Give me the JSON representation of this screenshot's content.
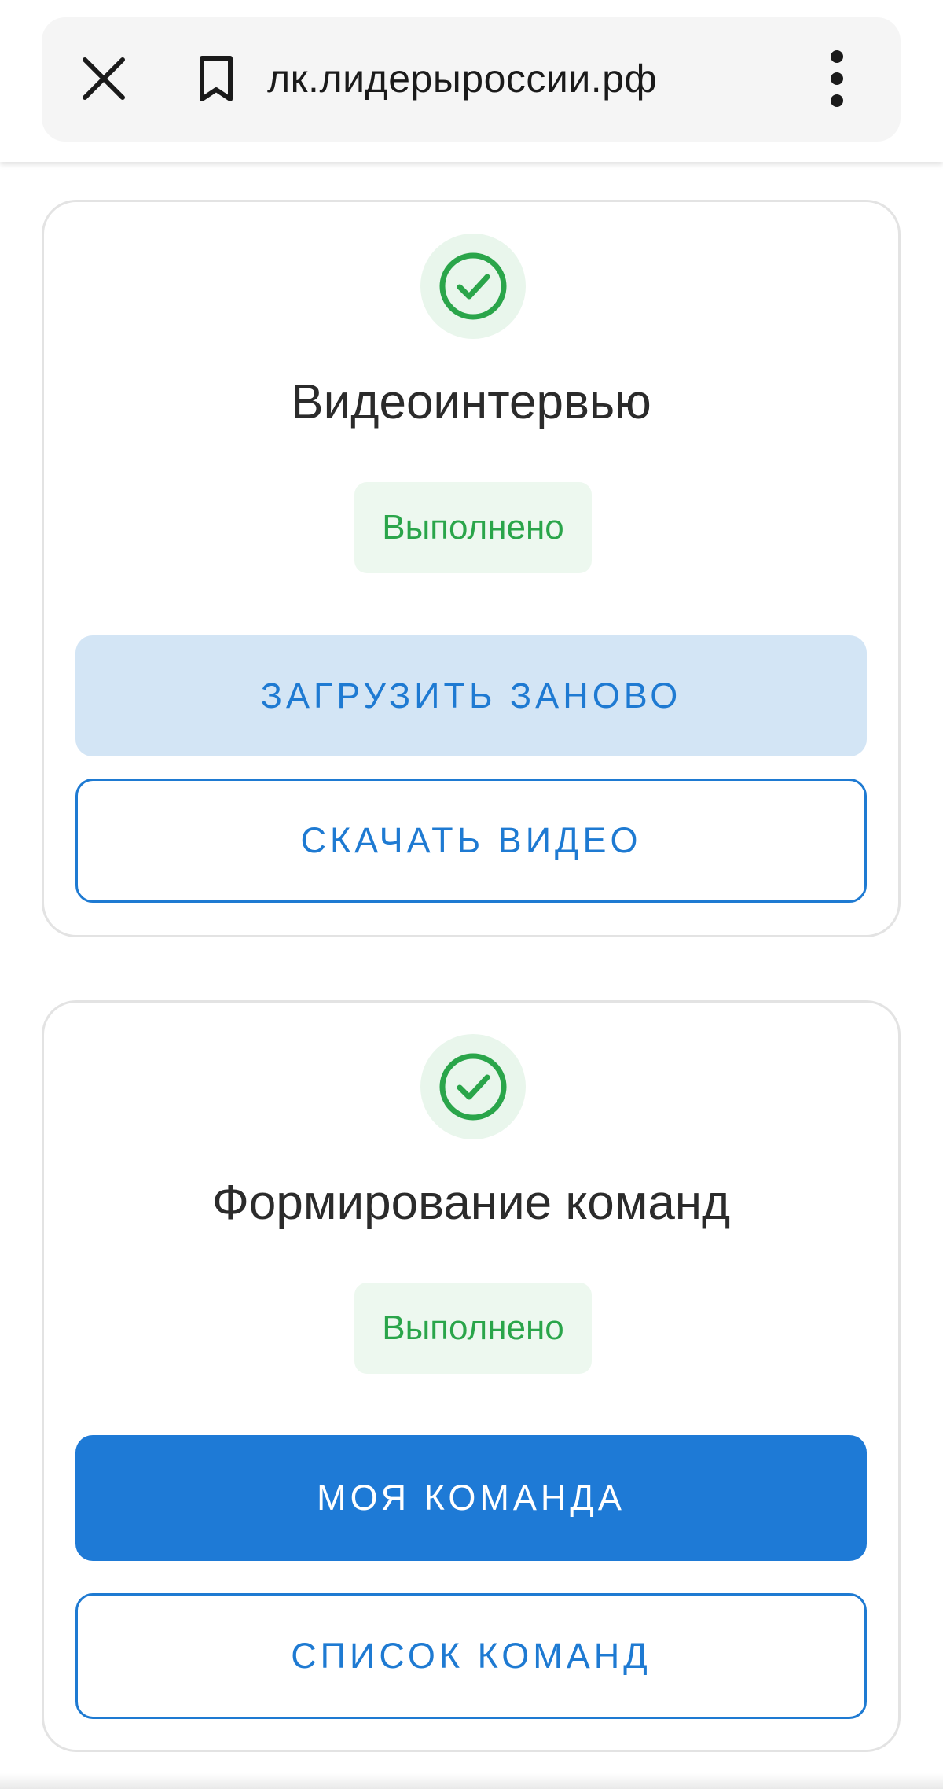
{
  "browser": {
    "url": "лк.лидерыроссии.рф",
    "close_icon": "close-icon",
    "bookmark_icon": "bookmark-icon",
    "menu_icon": "more-vert-icon"
  },
  "cards": [
    {
      "title": "Видеоинтервью",
      "status": "Выполнено",
      "status_icon": "check-circle-icon",
      "buttons": [
        {
          "label": "ЗАГРУЗИТЬ ЗАНОВО",
          "style": "light"
        },
        {
          "label": "СКАЧАТЬ ВИДЕО",
          "style": "outline"
        }
      ]
    },
    {
      "title": "Формирование команд",
      "status": "Выполнено",
      "status_icon": "check-circle-icon",
      "buttons": [
        {
          "label": "МОЯ КОМАНДА",
          "style": "primary"
        },
        {
          "label": "СПИСОК КОМАНД",
          "style": "outline"
        }
      ]
    }
  ],
  "colors": {
    "accent": "#1e7ad6",
    "success": "#2aa54a",
    "success_bg": "#e9f6ec",
    "light_button_bg": "#d3e5f5"
  }
}
